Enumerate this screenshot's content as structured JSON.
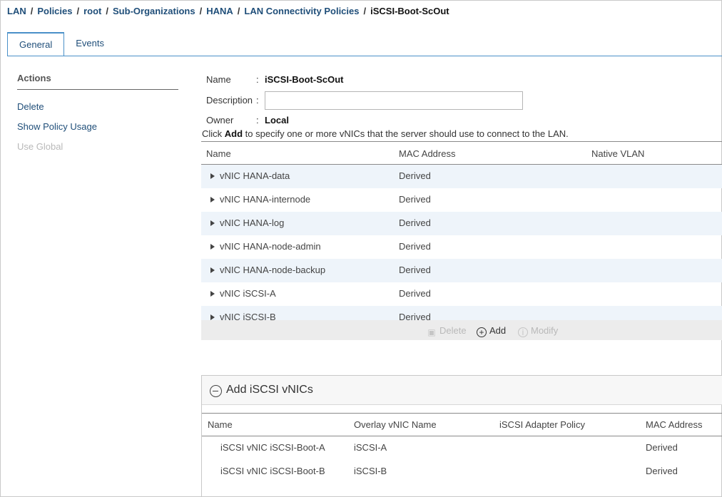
{
  "breadcrumb": [
    "LAN",
    "Policies",
    "root",
    "Sub-Organizations",
    "HANA",
    "LAN Connectivity Policies"
  ],
  "breadcrumb_current": "iSCSI-Boot-ScOut",
  "tabs": [
    {
      "label": "General",
      "active": true
    },
    {
      "label": "Events",
      "active": false
    }
  ],
  "actions": {
    "title": "Actions",
    "items": [
      {
        "label": "Delete",
        "enabled": true
      },
      {
        "label": "Show Policy Usage",
        "enabled": true
      },
      {
        "label": "Use Global",
        "enabled": false
      }
    ]
  },
  "properties": {
    "name_label": "Name",
    "name_value": "iSCSI-Boot-ScOut",
    "description_label": "Description",
    "description_value": "",
    "owner_label": "Owner",
    "owner_value": "Local"
  },
  "hint": {
    "prefix": "Click ",
    "bold": "Add",
    "suffix": " to specify one or more vNICs that the server should use to connect to the LAN."
  },
  "vnic_table": {
    "columns": [
      "Name",
      "MAC Address",
      "Native VLAN"
    ],
    "rows": [
      {
        "name": "vNIC HANA-data",
        "mac": "Derived"
      },
      {
        "name": "vNIC HANA-internode",
        "mac": "Derived"
      },
      {
        "name": "vNIC HANA-log",
        "mac": "Derived"
      },
      {
        "name": "vNIC HANA-node-admin",
        "mac": "Derived"
      },
      {
        "name": "vNIC HANA-node-backup",
        "mac": "Derived"
      },
      {
        "name": "vNIC iSCSI-A",
        "mac": "Derived"
      },
      {
        "name": "vNIC iSCSI-B",
        "mac": "Derived"
      }
    ],
    "toolbar": {
      "delete": "Delete",
      "add": "Add",
      "modify": "Modify"
    }
  },
  "iscsi_panel": {
    "title": "Add iSCSI vNICs",
    "columns": [
      "Name",
      "Overlay vNIC Name",
      "iSCSI Adapter Policy",
      "MAC Address"
    ],
    "rows": [
      {
        "name": "iSCSI vNIC iSCSI-Boot-A",
        "overlay": "iSCSI-A",
        "adapter": "",
        "mac": "Derived"
      },
      {
        "name": "iSCSI vNIC iSCSI-Boot-B",
        "overlay": "iSCSI-B",
        "adapter": "",
        "mac": "Derived"
      }
    ]
  },
  "colors": {
    "link": "#1f4e79",
    "tab_border": "#4a90c8",
    "row_alt": "#eef4fa",
    "disabled": "#b9b9b9"
  }
}
